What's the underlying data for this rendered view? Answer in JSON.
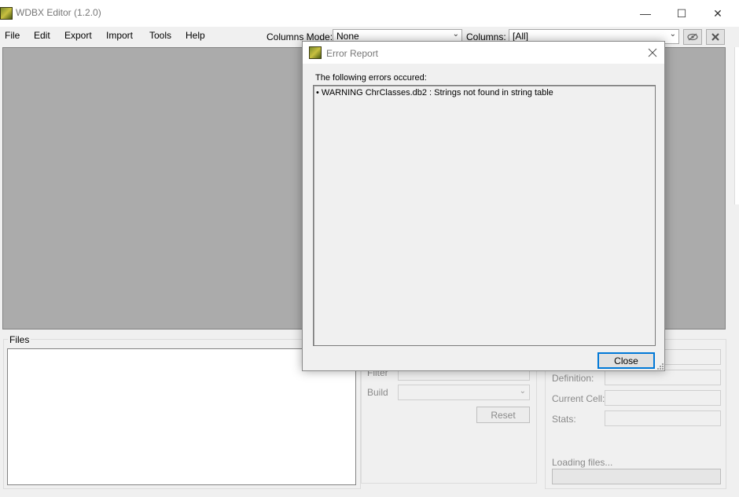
{
  "window": {
    "title": "WDBX Editor (1.2.0)",
    "minimize_glyph": "—",
    "maximize_glyph": "☐",
    "close_glyph": "✕"
  },
  "menu": [
    {
      "label": "File"
    },
    {
      "label": "Edit"
    },
    {
      "label": "Export"
    },
    {
      "label": "Import"
    },
    {
      "label": "Tools"
    },
    {
      "label": "Help"
    }
  ],
  "toolbar": {
    "columns_mode_label": "Columns Mode:",
    "columns_mode_value": "None",
    "columns_label": "Columns:",
    "columns_value": "[All]",
    "hide_icon": "eye-slash-icon",
    "clear_icon": "close-icon"
  },
  "files_panel": {
    "label": "Files"
  },
  "filter_panel": {
    "filter_label": "Filter",
    "build_label": "Build",
    "reset_label": "Reset"
  },
  "info_panel": {
    "definition_label": "Definition:",
    "current_cell_label": "Current Cell:",
    "stats_label": "Stats:",
    "loading_label": "Loading files..."
  },
  "dialog": {
    "title": "Error Report",
    "message": "The following errors occured:",
    "errors": [
      "• WARNING ChrClasses.db2 : Strings not found in string table"
    ],
    "close_label": "Close"
  },
  "colors": {
    "grid_background": "#ababab",
    "focus_border": "#0078d7"
  }
}
